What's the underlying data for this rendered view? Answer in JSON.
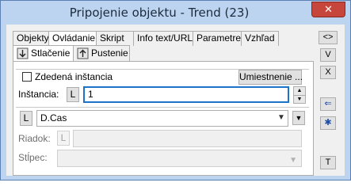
{
  "window": {
    "title": "Pripojenie objektu - Trend (23)",
    "close_glyph": "✕"
  },
  "tabs": [
    {
      "label": "Objekty"
    },
    {
      "label": "Ovládanie"
    },
    {
      "label": "Skript"
    },
    {
      "label": "Info text/URL"
    },
    {
      "label": "Parametre"
    },
    {
      "label": "Vzhľad"
    }
  ],
  "subtabs": [
    {
      "label": "Stlačenie"
    },
    {
      "label": "Pustenie"
    }
  ],
  "form": {
    "inherited_instance_label": "Zdedená inštancia",
    "placement_button": "Umiestnenie ...",
    "instance_label": "Inštancia:",
    "l_button": "L",
    "instance_value": "1",
    "spin_up": "▲",
    "spin_down": "▼",
    "object_value": "D.Cas",
    "combo_arrow": "▼",
    "row_label": "Riadok:",
    "column_label": "Stĺpec:"
  },
  "side_buttons": {
    "expand": "<>",
    "v": "V",
    "x": "X",
    "back": "⇐",
    "star": "✱",
    "t": "T"
  }
}
